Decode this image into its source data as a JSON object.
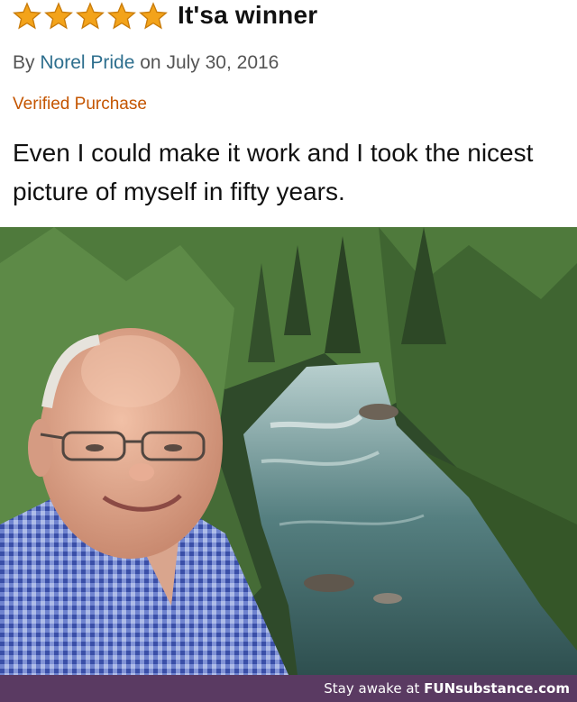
{
  "review": {
    "rating": 5,
    "rating_max": 5,
    "title": "It'sa winner",
    "by_prefix": "By",
    "author": "Norel Pride",
    "date_text": "on July 30, 2016",
    "verified": "Verified Purchase",
    "body": "Even I could make it work and I took the nicest picture of myself in fifty years."
  },
  "photo": {
    "subject": "selfie-river-forest"
  },
  "watermark": {
    "prefix": "Stay awake at ",
    "brand": "FUNsubstance.com"
  },
  "colors": {
    "star": "#f3a31a",
    "author_link": "#2e6f8e",
    "verified": "#c45500",
    "watermark_bar": "#5a3a62"
  }
}
